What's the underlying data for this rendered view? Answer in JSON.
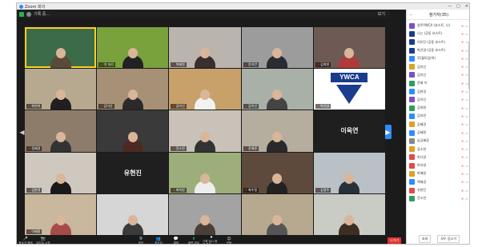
{
  "window": {
    "title": "Zoom 회의",
    "controls": [
      "—",
      "□",
      "✕"
    ]
  },
  "topbar": {
    "meeting_label": "기록 중...",
    "view_label": "보기"
  },
  "grid": {
    "tiles": [
      {
        "name": "",
        "bg": "#3c6b4a",
        "shirt": "#5a4a3a",
        "active": true
      },
      {
        "name": "이 지리",
        "bg": "#7aa23c",
        "shirt": "#222"
      },
      {
        "name": "박혜원",
        "bg": "#b9b4ad",
        "shirt": "#3a2e2e"
      },
      {
        "name": "윤지란",
        "bg": "#9c9c9c",
        "shirt": "#2b2b33"
      },
      {
        "name": "김희현",
        "bg": "#6e5a55",
        "shirt": "#b03a3a"
      },
      {
        "name": "최연희",
        "bg": "#b7a990",
        "shirt": "#1f1f1f"
      },
      {
        "name": "김이선",
        "bg": "#a69176",
        "shirt": "#2a2a2a"
      },
      {
        "name": "김미선",
        "bg": "#c8a06a",
        "shirt": "#f2f2f2"
      },
      {
        "name": "김이선",
        "bg": "#a8b0a8",
        "shirt": "#444"
      },
      {
        "name": "박선영",
        "bg": "#ffffff",
        "shirt": "#ffffff",
        "ywca": "YWCA"
      },
      {
        "name": "정혜경",
        "bg": "#8e7c6b",
        "shirt": "#333"
      },
      {
        "name": "",
        "bg": "#3a3a3a",
        "shirt": "#4c2a22"
      },
      {
        "name": "윤소연",
        "bg": "#c8c2b8",
        "shirt": "#333"
      },
      {
        "name": "장혜원",
        "bg": "#b5ae9f",
        "shirt": "#2a2a2a"
      },
      {
        "name": "",
        "bg": "#1f1f1f",
        "shirt": "#1f1f1f",
        "bigname": "이옥연"
      },
      {
        "name": "김현경",
        "bg": "#cfc8bf",
        "shirt": "#1a1a1a"
      },
      {
        "name": "",
        "bg": "#1f1f1f",
        "shirt": "#1f1f1f",
        "bigname": "유현진"
      },
      {
        "name": "최희원",
        "bg": "#9cae7a",
        "shirt": "#eee"
      },
      {
        "name": "최수정",
        "bg": "#5e4a3c",
        "shirt": "#222"
      },
      {
        "name": "김경주",
        "bg": "#b9c0c6",
        "shirt": "#263238"
      },
      {
        "name": "이혜원",
        "bg": "#c9b79e",
        "shirt": "#a74a4a"
      },
      {
        "name": "",
        "bg": "#d6d6d6",
        "shirt": "#3b3b3b"
      },
      {
        "name": "",
        "bg": "#a3a3a3",
        "shirt": "#4a3f36"
      },
      {
        "name": "",
        "bg": "#b7a98f",
        "shirt": "#555"
      },
      {
        "name": "",
        "bg": "#c8ccc4",
        "shirt": "#3c2e22"
      }
    ]
  },
  "nav": {
    "prev": "◀",
    "next": "▶"
  },
  "toolbar": {
    "buttons": [
      {
        "icon": "🎤",
        "label": "음소거 해제",
        "name": "unmute"
      },
      {
        "icon": "📷",
        "label": "비디오 시작",
        "name": "start-video"
      },
      {
        "icon": "⛨",
        "label": "보안",
        "name": "security"
      },
      {
        "icon": "👥",
        "label": "참가자",
        "name": "participants"
      },
      {
        "icon": "💬",
        "label": "채팅",
        "name": "chat"
      },
      {
        "icon": "⬆",
        "label": "화면 공유",
        "name": "share-screen"
      },
      {
        "icon": "⏺",
        "label": "기록 일시 중지/중지",
        "name": "record"
      },
      {
        "icon": "☺",
        "label": "반응",
        "name": "reactions"
      }
    ],
    "end_label": "나가기"
  },
  "participants_panel": {
    "title": "참가자(35)",
    "items": [
      {
        "name": "청주YWCA (호스트, 나)",
        "color": "#7b4fc9"
      },
      {
        "name": "나는 (공동 호스트)",
        "color": "#1a3c8c"
      },
      {
        "name": "이유진 (공동 호스트)",
        "color": "#1a3c8c"
      },
      {
        "name": "박선영 (공동 호스트)",
        "color": "#1a3c8c"
      },
      {
        "name": "11월모임(박)",
        "color": "#2d8cff"
      },
      {
        "name": "김미선",
        "color": "#e0a020"
      },
      {
        "name": "김미선",
        "color": "#7b4fc9"
      },
      {
        "name": "윤혜 이",
        "color": "#2d9d5a"
      },
      {
        "name": "김현경",
        "color": "#2d8cff"
      },
      {
        "name": "김이선",
        "color": "#7b4fc9"
      },
      {
        "name": "김희현",
        "color": "#2d9d5a"
      },
      {
        "name": "김지연",
        "color": "#2d8cff"
      },
      {
        "name": "김혜경",
        "color": "#e0a020"
      },
      {
        "name": "김혜원",
        "color": "#2d8cff"
      },
      {
        "name": "남궁혜경",
        "color": "#888888"
      },
      {
        "name": "류소현",
        "color": "#e0a020"
      },
      {
        "name": "박다경",
        "color": "#e34a4a"
      },
      {
        "name": "박지영",
        "color": "#e34a4a"
      },
      {
        "name": "박혜원",
        "color": "#e0a020"
      },
      {
        "name": "백혜경",
        "color": "#2d8cff"
      },
      {
        "name": "유현진",
        "color": "#e34a4a"
      },
      {
        "name": "윤소연",
        "color": "#2d9d5a"
      }
    ],
    "footer": [
      "초대",
      "모두 음소거"
    ]
  }
}
